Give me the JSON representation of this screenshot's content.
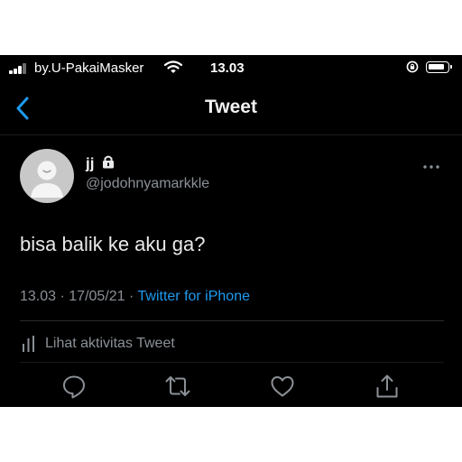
{
  "status_bar": {
    "carrier": "by.U-PakaiMasker",
    "time": "13.03",
    "icons": [
      "signal-icon",
      "wifi-icon",
      "rotation-lock-icon",
      "battery-icon"
    ]
  },
  "header": {
    "title": "Tweet",
    "back_icon": "chevron-left-icon"
  },
  "tweet": {
    "author_name": "jj",
    "author_handle": "@jodohnyamarkkle",
    "protected_icon": "lock-icon",
    "text": "bisa balik ke aku ga?",
    "time": "13.03",
    "date": "17/05/21",
    "separator": "·",
    "source": "Twitter for iPhone",
    "activity_label": "Lihat aktivitas Tweet"
  },
  "actions": [
    "reply-icon",
    "retweet-icon",
    "like-icon",
    "share-icon"
  ],
  "colors": {
    "background": "#000000",
    "accent": "#1d9bf0",
    "secondary_text": "#8b9096",
    "primary_text": "#e7e9ea"
  }
}
